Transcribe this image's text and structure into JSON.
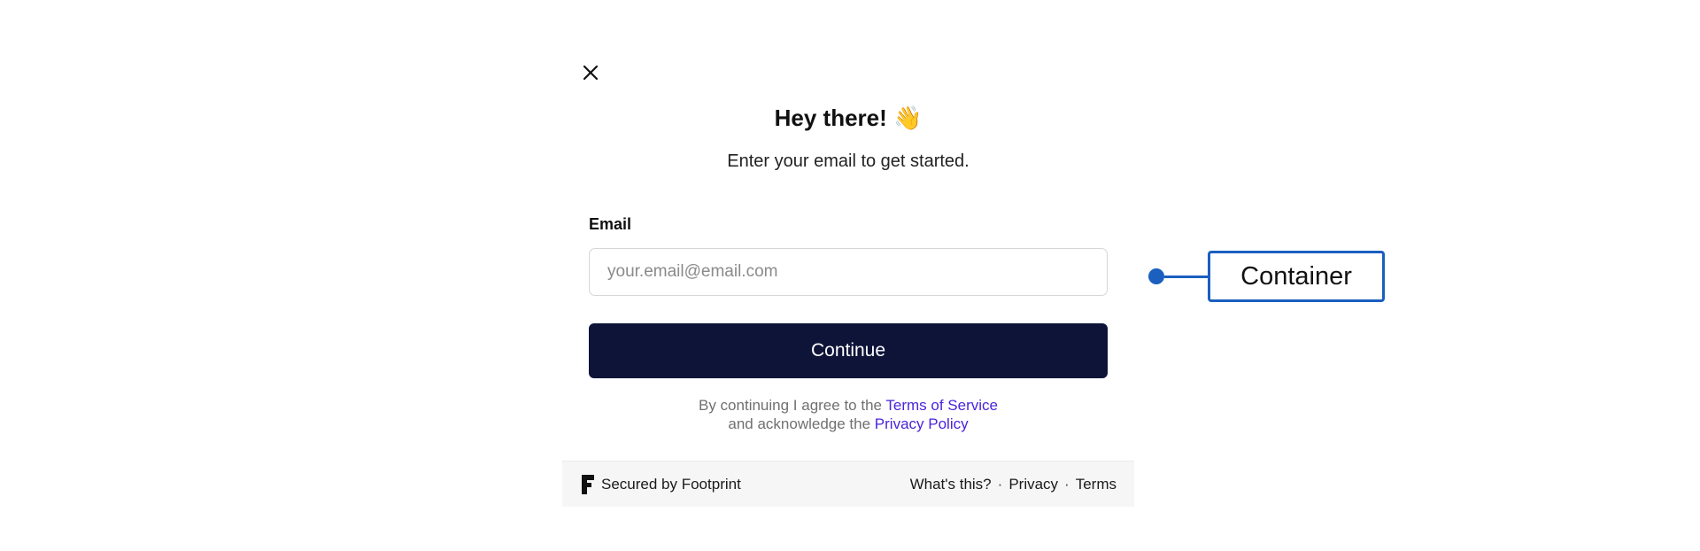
{
  "modal": {
    "title": "Hey there! 👋",
    "subtitle": "Enter your email to get started.",
    "email_label": "Email",
    "email_placeholder": "your.email@email.com",
    "email_value": "",
    "continue_label": "Continue",
    "legal": {
      "prefix": "By continuing I agree to the",
      "terms_link": "Terms of Service",
      "middle": "and acknowledge the",
      "privacy_link": "Privacy Policy"
    },
    "icons": {
      "close": "close-icon",
      "footprint": "footprint-logo-icon"
    }
  },
  "footer": {
    "secured_by": "Secured by Footprint",
    "whats_this": "What's this?",
    "privacy": "Privacy",
    "terms": "Terms",
    "separator": "·"
  },
  "annotation": {
    "label": "Container"
  },
  "colors": {
    "primary_button": "#0e1438",
    "link": "#4a24db",
    "annotation": "#1b5fbf",
    "footer_bg": "#f6f6f6"
  }
}
